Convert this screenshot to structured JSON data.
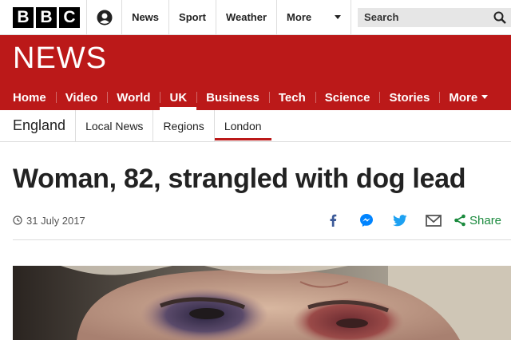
{
  "masthead": {
    "logo_letters": [
      "B",
      "B",
      "C"
    ],
    "account_icon": "user-icon",
    "nav": [
      "News",
      "Sport",
      "Weather",
      "More"
    ],
    "search_label": "Search",
    "search_icon": "search-icon"
  },
  "brand": {
    "title": "NEWS",
    "color": "#bb1919"
  },
  "main_nav": {
    "items": [
      "Home",
      "Video",
      "World",
      "UK",
      "Business",
      "Tech",
      "Science",
      "Stories",
      "More"
    ],
    "active": "UK"
  },
  "sub_nav": {
    "region": "England",
    "items": [
      "Local News",
      "Regions",
      "London"
    ],
    "active": "London"
  },
  "article": {
    "headline": "Woman, 82, strangled with dog lead",
    "date": "31 July 2017",
    "share_label": "Share",
    "share_icons": [
      "facebook-icon",
      "messenger-icon",
      "twitter-icon",
      "email-icon"
    ]
  },
  "colors": {
    "facebook": "#3b5998",
    "messenger": "#0084ff",
    "twitter": "#1da1f2",
    "email": "#555555",
    "share": "#1a8a3d"
  }
}
